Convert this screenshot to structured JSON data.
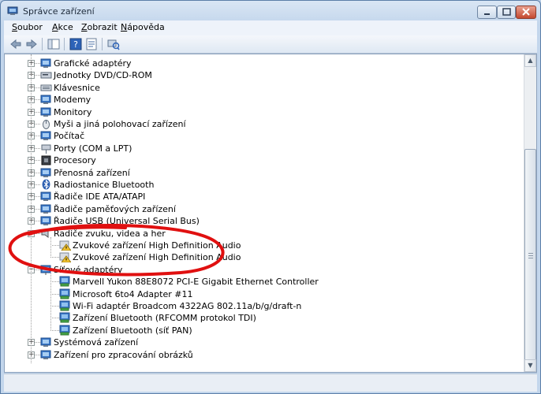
{
  "window": {
    "title": "Správce zařízení"
  },
  "menu": [
    {
      "label": "Soubor",
      "hotkey": "S",
      "rest": "oubor"
    },
    {
      "label": "Akce",
      "hotkey": "A",
      "rest": "kce"
    },
    {
      "label": "Zobrazit",
      "hotkey": "Z",
      "rest": "obrazit"
    },
    {
      "label": "Nápověda",
      "hotkey": "N",
      "rest": "ápověda"
    }
  ],
  "tree": [
    {
      "label": "Grafické adaptéry",
      "icon": "display-adapter-icon",
      "level": 0,
      "expander": "+"
    },
    {
      "label": "Jednotky DVD/CD-ROM",
      "icon": "dvd-drive-icon",
      "level": 0,
      "expander": "+"
    },
    {
      "label": "Klávesnice",
      "icon": "keyboard-icon",
      "level": 0,
      "expander": "+"
    },
    {
      "label": "Modemy",
      "icon": "modem-icon",
      "level": 0,
      "expander": "+"
    },
    {
      "label": "Monitory",
      "icon": "monitor-icon",
      "level": 0,
      "expander": "+"
    },
    {
      "label": "Myši a jiná polohovací zařízení",
      "icon": "mouse-icon",
      "level": 0,
      "expander": "+"
    },
    {
      "label": "Počítač",
      "icon": "computer-icon",
      "level": 0,
      "expander": "+"
    },
    {
      "label": "Porty (COM a LPT)",
      "icon": "port-icon",
      "level": 0,
      "expander": "+"
    },
    {
      "label": "Procesory",
      "icon": "processor-icon",
      "level": 0,
      "expander": "+"
    },
    {
      "label": "Přenosná zařízení",
      "icon": "portable-device-icon",
      "level": 0,
      "expander": "+"
    },
    {
      "label": "Radiostanice Bluetooth",
      "icon": "bluetooth-icon",
      "level": 0,
      "expander": "+"
    },
    {
      "label": "Řadiče IDE ATA/ATAPI",
      "icon": "ide-controller-icon",
      "level": 0,
      "expander": "+"
    },
    {
      "label": "Řadiče paměťových zařízení",
      "icon": "storage-controller-icon",
      "level": 0,
      "expander": "+"
    },
    {
      "label": "Řadiče USB (Universal Serial Bus)",
      "icon": "usb-controller-icon",
      "level": 0,
      "expander": "+"
    },
    {
      "label": "Řadiče zvuku, videa a her",
      "icon": "sound-icon",
      "level": 0,
      "expander": "−"
    },
    {
      "label": "Zvukové zařízení High Definition Audio",
      "icon": "warning-device-icon",
      "level": 1,
      "expander": ""
    },
    {
      "label": "Zvukové zařízení High Definition Audio",
      "icon": "warning-device-icon",
      "level": 1,
      "expander": ""
    },
    {
      "label": "Síťové adaptéry",
      "icon": "network-adapter-icon",
      "level": 0,
      "expander": "−"
    },
    {
      "label": "Marvell Yukon 88E8072 PCI-E Gigabit Ethernet Controller",
      "icon": "network-card-icon",
      "level": 1,
      "expander": ""
    },
    {
      "label": "Microsoft 6to4 Adapter #11",
      "icon": "network-card-icon",
      "level": 1,
      "expander": ""
    },
    {
      "label": "Wi-Fi adaptér Broadcom 4322AG 802.11a/b/g/draft-n",
      "icon": "network-card-icon",
      "level": 1,
      "expander": ""
    },
    {
      "label": "Zařízení Bluetooth (RFCOMM protokol TDI)",
      "icon": "network-card-icon",
      "level": 1,
      "expander": ""
    },
    {
      "label": "Zařízení Bluetooth (síť PAN)",
      "icon": "network-card-icon",
      "level": 1,
      "expander": ""
    },
    {
      "label": "Systémová zařízení",
      "icon": "system-device-icon",
      "level": 0,
      "expander": "+"
    },
    {
      "label": "Zařízení pro zpracování obrázků",
      "icon": "imaging-device-icon",
      "level": 0,
      "expander": "+"
    }
  ]
}
